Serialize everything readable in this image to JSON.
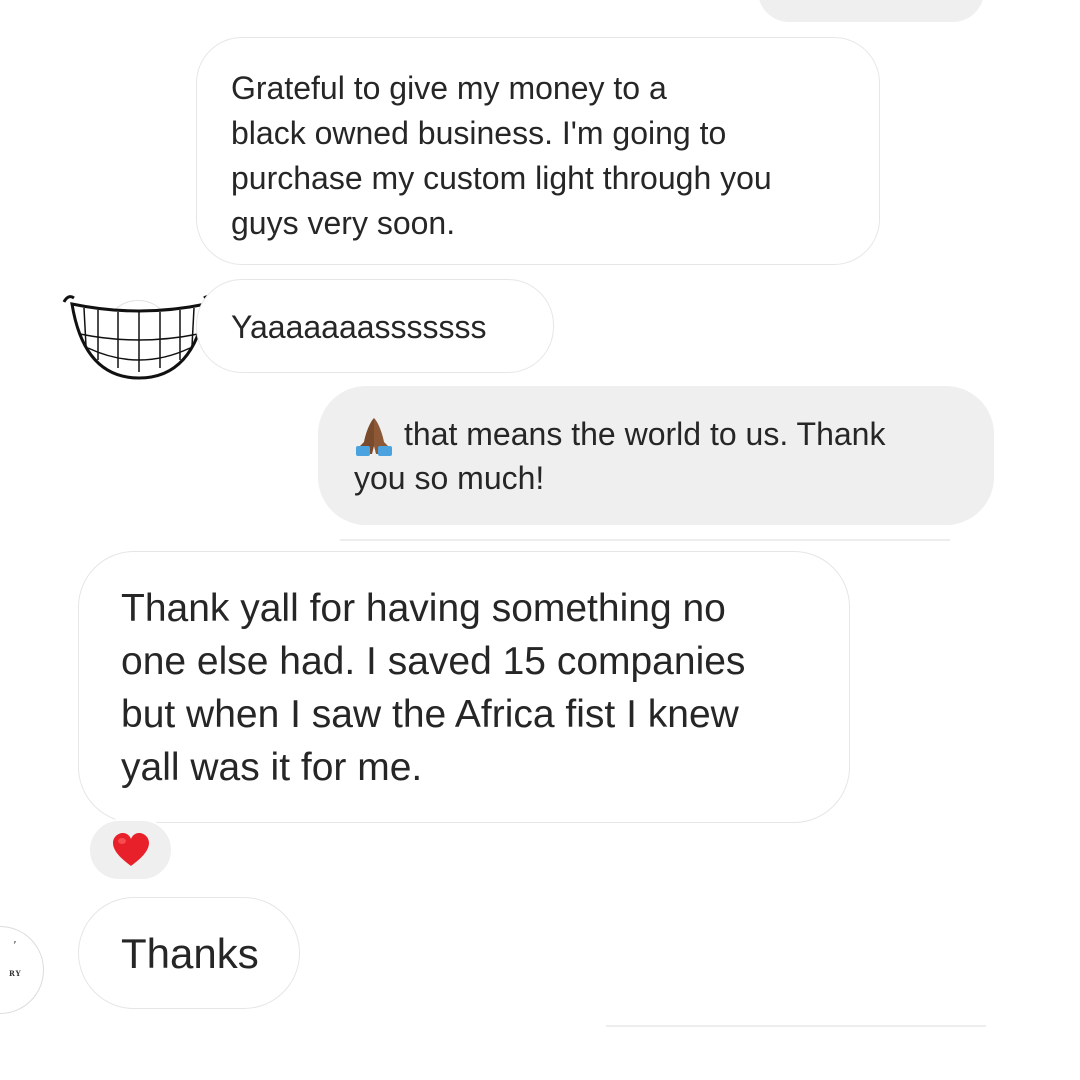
{
  "thread": {
    "messages": [
      {
        "sender": "other",
        "text": "Grateful to give my money to a\nblack owned business. I'm going to\npurchase my custom light through you\nguys very soon."
      },
      {
        "sender": "other",
        "text": "Yaaaaaaasssssss"
      },
      {
        "sender": "me",
        "emoji": "folded-hands-icon",
        "text": "that means the world to us. Thank\nyou so much!"
      },
      {
        "sender": "other",
        "text": "Thank yall for having something no\none else had. I saved 15 companies\nbut when I saw the Africa fist I knew\nyall was it for me.",
        "reaction": "red-heart-icon"
      },
      {
        "sender": "other",
        "text": "Thanks"
      }
    ],
    "avatar_bottom": {
      "mark": "’",
      "text": "RY"
    }
  },
  "colors": {
    "sent_bubble": "#efefef",
    "received_border": "#e6e6e6",
    "text": "#262626",
    "heart": "#e8202a",
    "skin": "#7a4a2c",
    "sleeve": "#4aa3df"
  }
}
